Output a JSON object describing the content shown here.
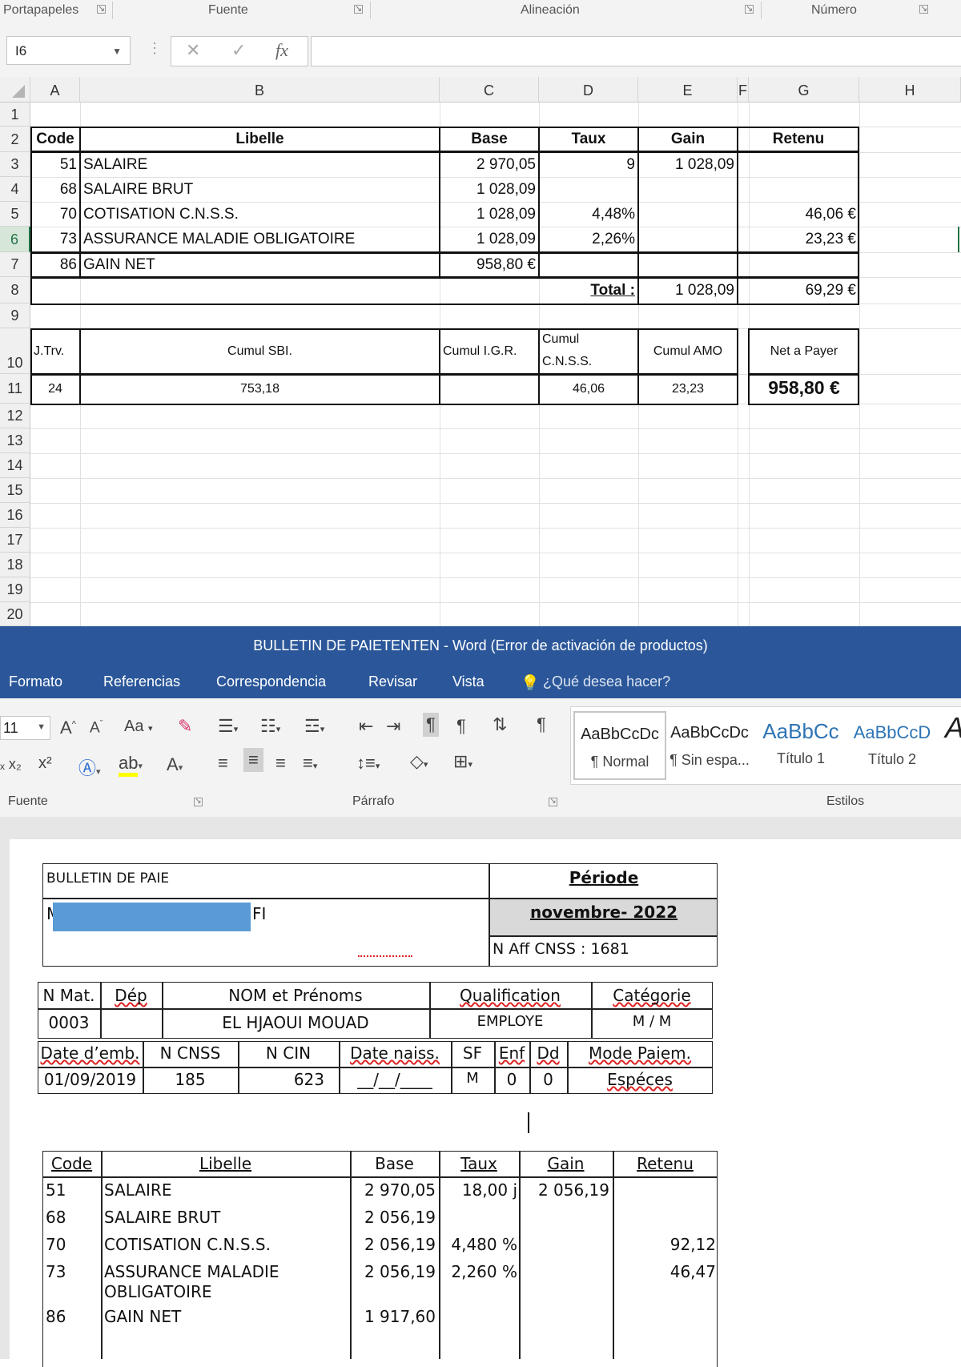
{
  "excel": {
    "ribbon_groups": [
      "Portapapeles",
      "Fuente",
      "Alineación",
      "Número"
    ],
    "name_box": "I6",
    "formula_icons": {
      "cancel": "✕",
      "enter": "✓",
      "fx": "fx"
    },
    "columns": [
      "A",
      "B",
      "C",
      "D",
      "E",
      "F",
      "G",
      "H"
    ],
    "rows": [
      "1",
      "2",
      "3",
      "4",
      "5",
      "6",
      "7",
      "8",
      "9",
      "10",
      "11",
      "12",
      "13",
      "14",
      "15",
      "16",
      "17",
      "18",
      "19",
      "20"
    ],
    "table1": {
      "headers": {
        "code": "Code",
        "libelle": "Libelle",
        "base": "Base",
        "taux": "Taux",
        "gain": "Gain",
        "retenu": "Retenu"
      },
      "rows": [
        {
          "code": "51",
          "libelle": "SALAIRE",
          "base": "2 970,05",
          "taux": "9",
          "gain": "1 028,09",
          "retenu": ""
        },
        {
          "code": "68",
          "libelle": "SALAIRE BRUT",
          "base": "1 028,09",
          "taux": "",
          "gain": "",
          "retenu": ""
        },
        {
          "code": "70",
          "libelle": "COTISATION C.N.S.S.",
          "base": "1 028,09",
          "taux": "4,48%",
          "gain": "",
          "retenu": "46,06 €"
        },
        {
          "code": "73",
          "libelle": "ASSURANCE MALADIE OBLIGATOIRE",
          "base": "1 028,09",
          "taux": "2,26%",
          "gain": "",
          "retenu": "23,23 €"
        },
        {
          "code": "86",
          "libelle": "GAIN NET",
          "base": "958,80 €",
          "taux": "",
          "gain": "",
          "retenu": ""
        }
      ],
      "total_label": "Total :",
      "total_gain": "1 028,09",
      "total_retenu": "69,29 €"
    },
    "table2": {
      "headers": {
        "jtrv": "J.Trv.",
        "cumul_sbi": "Cumul SBI.",
        "cumul_igr": "Cumul I.G.R.",
        "cumul_cnss_1": "Cumul",
        "cumul_cnss_2": "C.N.S.S.",
        "cumul_amo": "Cumul AMO",
        "net": "Net a Payer"
      },
      "values": {
        "jtrv": "24",
        "cumul_sbi": "753,18",
        "cumul_igr": "",
        "cumul_cnss": "46,06",
        "cumul_amo": "23,23",
        "net": "958,80 €"
      }
    }
  },
  "word": {
    "title": "BULLETIN DE PAIETENTEN - Word (Error de activación de productos)",
    "tabs": [
      "Formato",
      "Referencias",
      "Correspondencia",
      "Revisar",
      "Vista"
    ],
    "tell_me": "¿Qué desea hacer?",
    "font_size": "11",
    "case_label": "Aa",
    "group_labels": {
      "fuente": "Fuente",
      "parrafo": "Párrafo",
      "estilos": "Estilos"
    },
    "styles": [
      {
        "sample": "AaBbCcDc",
        "name": "¶ Normal"
      },
      {
        "sample": "AaBbCcDc",
        "name": "¶ Sin espa..."
      },
      {
        "sample": "AaBbCc",
        "name": "Título 1"
      },
      {
        "sample": "AaBbCcD",
        "name": "Título 2"
      }
    ],
    "doc": {
      "header": {
        "title": "BULLETIN DE PAIE",
        "periode_label": "Période",
        "periode_value": "novembre- 2022",
        "name_prefix": "M",
        "name_suffix": "FI",
        "aff_cnss": "N Aff CNSS : 1681"
      },
      "employee1": {
        "headers": [
          "N Mat.",
          "Dép",
          "NOM et Prénoms",
          "Qualification",
          "Catégorie"
        ],
        "values": [
          "0003",
          "",
          "EL HJAOUI MOUAD",
          "EMPLOYE",
          "M / M"
        ]
      },
      "employee2": {
        "headers": [
          "Date d’emb.",
          "N CNSS",
          "N CIN",
          "Date naiss.",
          "SF",
          "Enf",
          "Dd",
          "Mode Paiem."
        ],
        "values": [
          "01/09/2019",
          "185",
          "623",
          "__/__/____",
          "M",
          "0",
          "0",
          "Espéces"
        ]
      },
      "pay": {
        "headers": [
          "Code",
          "Libelle",
          "Base",
          "Taux",
          "Gain",
          "Retenu"
        ],
        "rows": [
          {
            "code": "51",
            "libelle": "SALAIRE",
            "libelle2": "",
            "base": "2 970,05",
            "taux": "18,00 j",
            "gain": "2 056,19",
            "retenu": ""
          },
          {
            "code": "68",
            "libelle": "SALAIRE BRUT",
            "libelle2": "",
            "base": "2 056,19",
            "taux": "",
            "gain": "",
            "retenu": ""
          },
          {
            "code": "70",
            "libelle": "COTISATION C.N.S.S.",
            "libelle2": "",
            "base": "2 056,19",
            "taux": "4,480 %",
            "gain": "",
            "retenu": "92,12"
          },
          {
            "code": "73",
            "libelle": "ASSURANCE MALADIE",
            "libelle2": "OBLIGATOIRE",
            "base": "2 056,19",
            "taux": "2,260 %",
            "gain": "",
            "retenu": "46,47"
          },
          {
            "code": "86",
            "libelle": "GAIN NET",
            "libelle2": "",
            "base": "1 917,60",
            "taux": "",
            "gain": "",
            "retenu": ""
          }
        ]
      }
    }
  }
}
